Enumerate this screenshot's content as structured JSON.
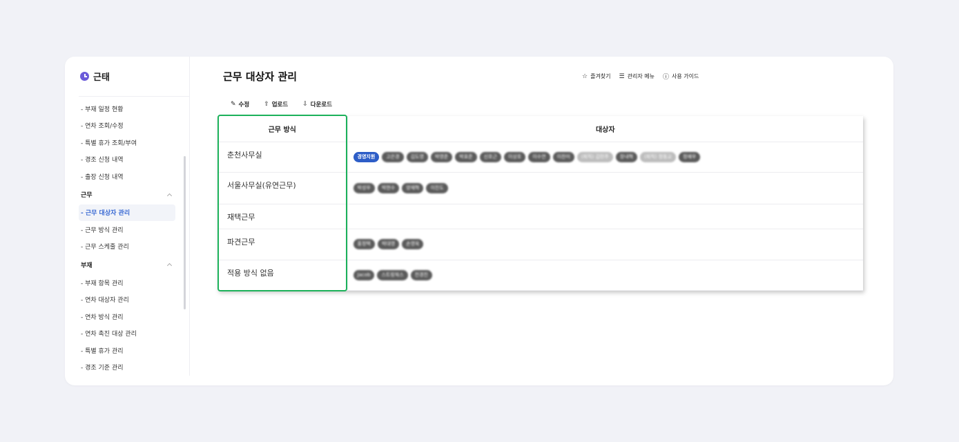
{
  "app": {
    "name": "근태"
  },
  "page": {
    "title": "근무 대상자 관리"
  },
  "topbar": {
    "favorites": "즐겨찾기",
    "admin_menu": "관리자 메뉴",
    "guide": "사용 가이드"
  },
  "toolbar": {
    "edit": "수정",
    "upload": "업로드",
    "download": "다운로드"
  },
  "sidebar": {
    "top_items": [
      "부재 일정 현황",
      "연차 조회/수정",
      "특별 휴가 조회/부여",
      "경조 신청 내역",
      "출장 신청 내역"
    ],
    "group_work": {
      "label": "근무",
      "items": [
        "근무 대상자 관리",
        "근무 방식 관리",
        "근무 스케줄 관리"
      ],
      "active": "근무 대상자 관리"
    },
    "group_absence": {
      "label": "부재",
      "items": [
        "부재 항목 관리",
        "연차 대상자 관리",
        "연차 방식 관리",
        "연차 촉진 대상 관리",
        "특별 휴가 관리",
        "경조 기준 관리"
      ]
    }
  },
  "table": {
    "headers": {
      "method": "근무 방식",
      "target": "대상자"
    },
    "rows": [
      {
        "method": "춘천사무실",
        "tags": [
          {
            "text": "경영지원",
            "style": "primary"
          },
          {
            "text": "고은경",
            "style": "dark"
          },
          {
            "text": "김도영",
            "style": "dark"
          },
          {
            "text": "박영준",
            "style": "dark"
          },
          {
            "text": "박효준",
            "style": "dark"
          },
          {
            "text": "신호근",
            "style": "dark"
          },
          {
            "text": "이상호",
            "style": "dark"
          },
          {
            "text": "이수연",
            "style": "dark"
          },
          {
            "text": "이찬미",
            "style": "dark"
          },
          {
            "text": "(퇴직) 김민주",
            "style": "light"
          },
          {
            "text": "장내혁",
            "style": "dark"
          },
          {
            "text": "(퇴직) 정동교",
            "style": "light"
          },
          {
            "text": "정예우",
            "style": "dark"
          }
        ]
      },
      {
        "method": "서울사무실(유연근무)",
        "tags": [
          {
            "text": "박성우",
            "style": "dark"
          },
          {
            "text": "박현수",
            "style": "dark"
          },
          {
            "text": "양재혁",
            "style": "dark"
          },
          {
            "text": "이진도",
            "style": "dark"
          }
        ]
      },
      {
        "method": "재택근무",
        "tags": []
      },
      {
        "method": "파견근무",
        "tags": [
          {
            "text": "홍정택",
            "style": "dark"
          },
          {
            "text": "박대영",
            "style": "dark"
          },
          {
            "text": "손영욱",
            "style": "dark"
          }
        ]
      },
      {
        "method": "적용 방식 없음",
        "tags": [
          {
            "text": "Jacob",
            "style": "dark"
          },
          {
            "text": "스트링웍스",
            "style": "dark"
          },
          {
            "text": "전경진",
            "style": "dark"
          }
        ]
      }
    ]
  },
  "colors": {
    "accent": "#3a6ad4",
    "primary_tag": "#2d5dc7",
    "highlight_border": "#1bb15a"
  }
}
